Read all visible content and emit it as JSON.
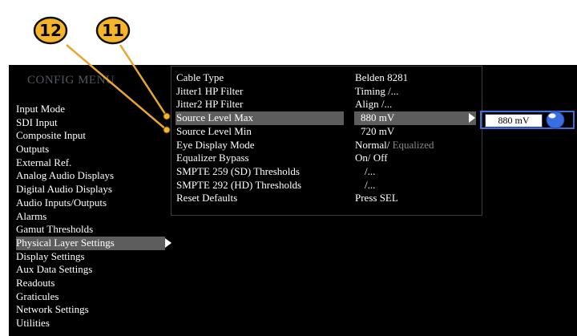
{
  "menu_title": "CONFIG MENU",
  "left_menu": [
    {
      "label": "Input Mode"
    },
    {
      "label": "SDI Input"
    },
    {
      "label": "Composite Input"
    },
    {
      "label": "Outputs"
    },
    {
      "label": "External Ref."
    },
    {
      "label": "Analog Audio Displays"
    },
    {
      "label": "Digital Audio Displays"
    },
    {
      "label": "Audio Inputs/Outputs"
    },
    {
      "label": "Alarms"
    },
    {
      "label": "Gamut Thresholds"
    },
    {
      "label": "Physical Layer Settings",
      "selected": true
    },
    {
      "label": "Display Settings"
    },
    {
      "label": "Aux Data Settings"
    },
    {
      "label": "Readouts"
    },
    {
      "label": "Graticules"
    },
    {
      "label": "Network Settings"
    },
    {
      "label": "Utilities"
    }
  ],
  "submenu": [
    {
      "label": "Cable Type",
      "value": "Belden 8281"
    },
    {
      "label": "Jitter1 HP Filter",
      "value": "Timing /..."
    },
    {
      "label": "Jitter2 HP Filter",
      "value": "Align /..."
    },
    {
      "label": "Source Level Max",
      "value": "880 mV"
    },
    {
      "label": "Source Level Min",
      "value": "720 mV"
    },
    {
      "label": "Eye Display Mode",
      "value": "Normal/",
      "value_dim": " Equalized"
    },
    {
      "label": "Equalizer Bypass",
      "value": "On/ Off"
    },
    {
      "label": "SMPTE 259 (SD) Thresholds",
      "value": "/..."
    },
    {
      "label": "SMPTE 292 (HD) Thresholds",
      "value": "/..."
    },
    {
      "label": "Reset Defaults",
      "value": "Press SEL"
    }
  ],
  "knob_control": {
    "value": "880 mV"
  },
  "callouts": [
    {
      "number": "12",
      "target": "Source Level Min"
    },
    {
      "number": "11",
      "target": "Source Level Max"
    }
  ],
  "colors": {
    "callout_fill": "#f5b42a",
    "callout_line": "#e8a531",
    "highlight": "#5d5d5d",
    "knob_border": "#3f6fd8"
  },
  "icons": {
    "knob": "knob-icon",
    "arrow": "right-triangle-icon"
  }
}
